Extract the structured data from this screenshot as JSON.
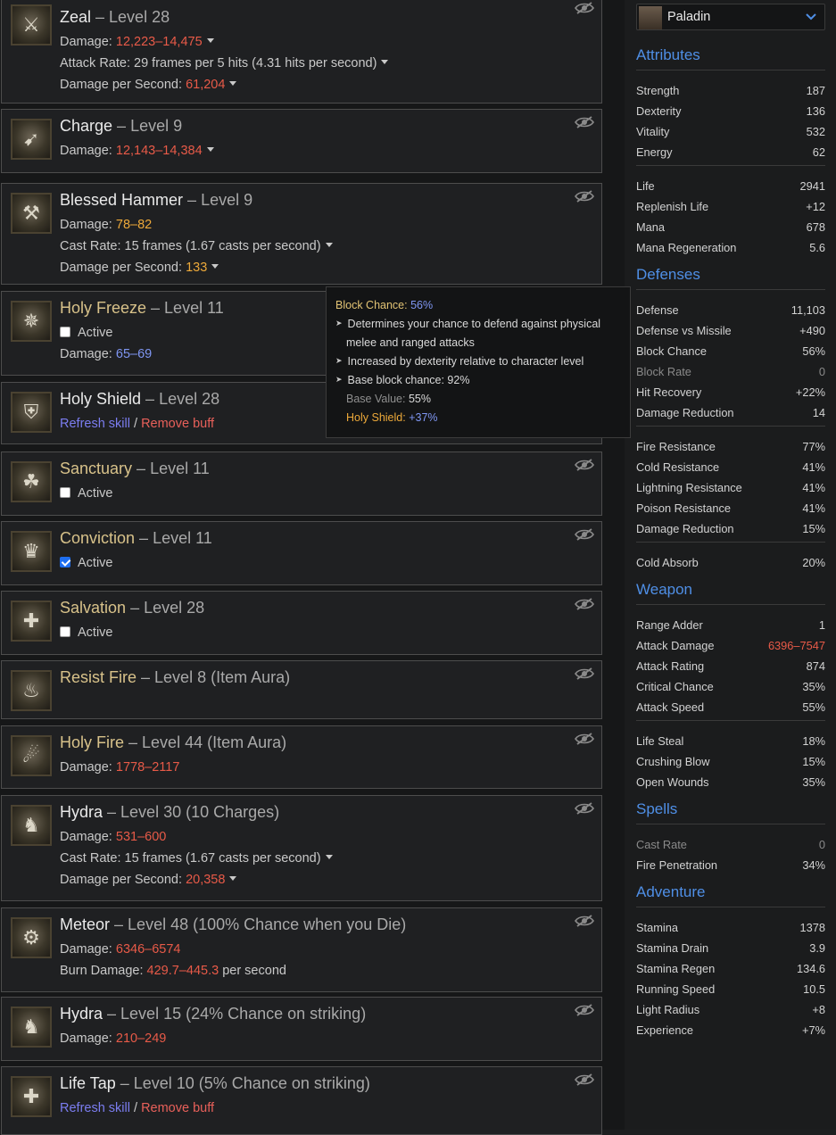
{
  "skills": [
    {
      "name": "Zeal",
      "level": "Level 28",
      "icon": "crossed-swords-icon",
      "rows": [
        {
          "label": "Damage: ",
          "value": "12,223–14,475",
          "color": "red",
          "caret": true
        },
        {
          "label": "Attack Rate: 29 frames per 5 hits (4.31 hits per second)",
          "value": "",
          "caret": true
        },
        {
          "label": "Damage per Second: ",
          "value": "61,204",
          "color": "red",
          "caret": true
        }
      ]
    },
    {
      "name": "Charge",
      "level": "Level 9",
      "icon": "charge-wing-icon",
      "rows": [
        {
          "label": "Damage: ",
          "value": "12,143–14,384",
          "color": "red",
          "caret": true
        }
      ]
    },
    {
      "name": "Blessed Hammer",
      "level": "Level 9",
      "icon": "hammer-icon",
      "rows": [
        {
          "label": "Damage: ",
          "value": "78–82",
          "color": "orange"
        },
        {
          "label": "Cast Rate: 15 frames (1.67 casts per second)",
          "value": "",
          "caret": true
        },
        {
          "label": "Damage per Second: ",
          "value": "133",
          "color": "orange",
          "caret": true
        }
      ]
    },
    {
      "name": "Holy Freeze",
      "level": "Level 11",
      "icon": "snowflake-aura-icon",
      "aura": true,
      "checkbox": {
        "label": "Active",
        "checked": false
      },
      "rows": [
        {
          "label": "Damage: ",
          "value": "65–69",
          "color": "blue"
        }
      ]
    },
    {
      "name": "Holy Shield",
      "level": "Level 28",
      "icon": "shield-icon",
      "links": {
        "refresh": "Refresh skill",
        "sep": " / ",
        "remove": "Remove buff"
      }
    },
    {
      "name": "Sanctuary",
      "level": "Level 11",
      "icon": "sanctuary-aura-icon",
      "aura": true,
      "checkbox": {
        "label": "Active",
        "checked": false
      }
    },
    {
      "name": "Conviction",
      "level": "Level 11",
      "icon": "conviction-aura-icon",
      "aura": true,
      "checkbox": {
        "label": "Active",
        "checked": true
      }
    },
    {
      "name": "Salvation",
      "level": "Level 28",
      "icon": "salvation-aura-icon",
      "aura": true,
      "checkbox": {
        "label": "Active",
        "checked": false
      }
    },
    {
      "name": "Resist Fire",
      "level": "Level 8 (Item Aura)",
      "icon": "resist-fire-aura-icon",
      "aura": true
    },
    {
      "name": "Holy Fire",
      "level": "Level 44 (Item Aura)",
      "icon": "holy-fire-aura-icon",
      "aura": true,
      "rows": [
        {
          "label": "Damage: ",
          "value": "1778–2117",
          "color": "red"
        }
      ]
    },
    {
      "name": "Hydra",
      "level": "Level 30 (10 Charges)",
      "icon": "hydra-icon",
      "rows": [
        {
          "label": "Damage: ",
          "value": "531–600",
          "color": "red"
        },
        {
          "label": "Cast Rate: 15 frames (1.67 casts per second)",
          "value": "",
          "caret": true
        },
        {
          "label": "Damage per Second: ",
          "value": "20,358",
          "color": "red",
          "caret": true
        }
      ]
    },
    {
      "name": "Meteor",
      "level": "Level 48 (100% Chance when you Die)",
      "icon": "meteor-gear-icon",
      "rows": [
        {
          "label": "Damage: ",
          "value": "6346–6574",
          "color": "red"
        },
        {
          "label": "Burn Damage: ",
          "value": "429.7–445.3",
          "color": "red",
          "suffix": " per second"
        }
      ]
    },
    {
      "name": "Hydra",
      "level": "Level 15 (24% Chance on striking)",
      "icon": "hydra-icon",
      "rows": [
        {
          "label": "Damage: ",
          "value": "210–249",
          "color": "red"
        }
      ]
    },
    {
      "name": "Life Tap",
      "level": "Level 10 (5% Chance on striking)",
      "icon": "life-tap-icon",
      "links": {
        "refresh": "Refresh skill",
        "sep": " / ",
        "remove": "Remove buff"
      }
    }
  ],
  "tooltip": {
    "title_label": "Block Chance: ",
    "title_value": "56%",
    "bullets": [
      "Determines your chance to defend against physical",
      "melee and ranged attacks",
      "Increased by dexterity relative to character level",
      "Base block chance: 92%"
    ],
    "base_label": "Base Value: ",
    "base_value": "55%",
    "holy_label": "Holy Shield: ",
    "holy_value": "+37%"
  },
  "class_select": {
    "value": "Paladin"
  },
  "sections": [
    {
      "title": "Attributes",
      "groups": [
        [
          [
            "Strength",
            "187"
          ],
          [
            "Dexterity",
            "136"
          ],
          [
            "Vitality",
            "532"
          ],
          [
            "Energy",
            "62"
          ]
        ],
        [
          [
            "Life",
            "2941"
          ],
          [
            "Replenish Life",
            "+12"
          ],
          [
            "Mana",
            "678"
          ],
          [
            "Mana Regeneration",
            "5.6"
          ]
        ]
      ]
    },
    {
      "title": "Defenses",
      "groups": [
        [
          [
            "Defense",
            "11,103"
          ],
          [
            "Defense vs Missile",
            "+490"
          ],
          [
            "Block Chance",
            "56%"
          ],
          [
            "Block Rate",
            "0",
            "dim"
          ],
          [
            "Hit Recovery",
            "+22%"
          ],
          [
            "Damage Reduction",
            "14"
          ]
        ],
        [
          [
            "Fire Resistance",
            "77%"
          ],
          [
            "Cold Resistance",
            "41%"
          ],
          [
            "Lightning Resistance",
            "41%"
          ],
          [
            "Poison Resistance",
            "41%"
          ],
          [
            "Damage Reduction",
            "15%"
          ]
        ],
        [
          [
            "Cold Absorb",
            "20%"
          ]
        ]
      ]
    },
    {
      "title": "Weapon",
      "groups": [
        [
          [
            "Range Adder",
            "1"
          ],
          [
            "Attack Damage",
            "6396–7547",
            "red"
          ],
          [
            "Attack Rating",
            "874"
          ],
          [
            "Critical Chance",
            "35%"
          ],
          [
            "Attack Speed",
            "55%"
          ]
        ],
        [
          [
            "Life Steal",
            "18%"
          ],
          [
            "Crushing Blow",
            "15%"
          ],
          [
            "Open Wounds",
            "35%"
          ]
        ]
      ]
    },
    {
      "title": "Spells",
      "groups": [
        [
          [
            "Cast Rate",
            "0",
            "dim"
          ],
          [
            "Fire Penetration",
            "34%"
          ]
        ]
      ]
    },
    {
      "title": "Adventure",
      "groups": [
        [
          [
            "Stamina",
            "1378"
          ],
          [
            "Stamina Drain",
            "3.9"
          ],
          [
            "Stamina Regen",
            "134.6"
          ],
          [
            "Running Speed",
            "10.5"
          ],
          [
            "Light Radius",
            "+8"
          ],
          [
            "Experience",
            "+7%"
          ]
        ]
      ]
    }
  ]
}
